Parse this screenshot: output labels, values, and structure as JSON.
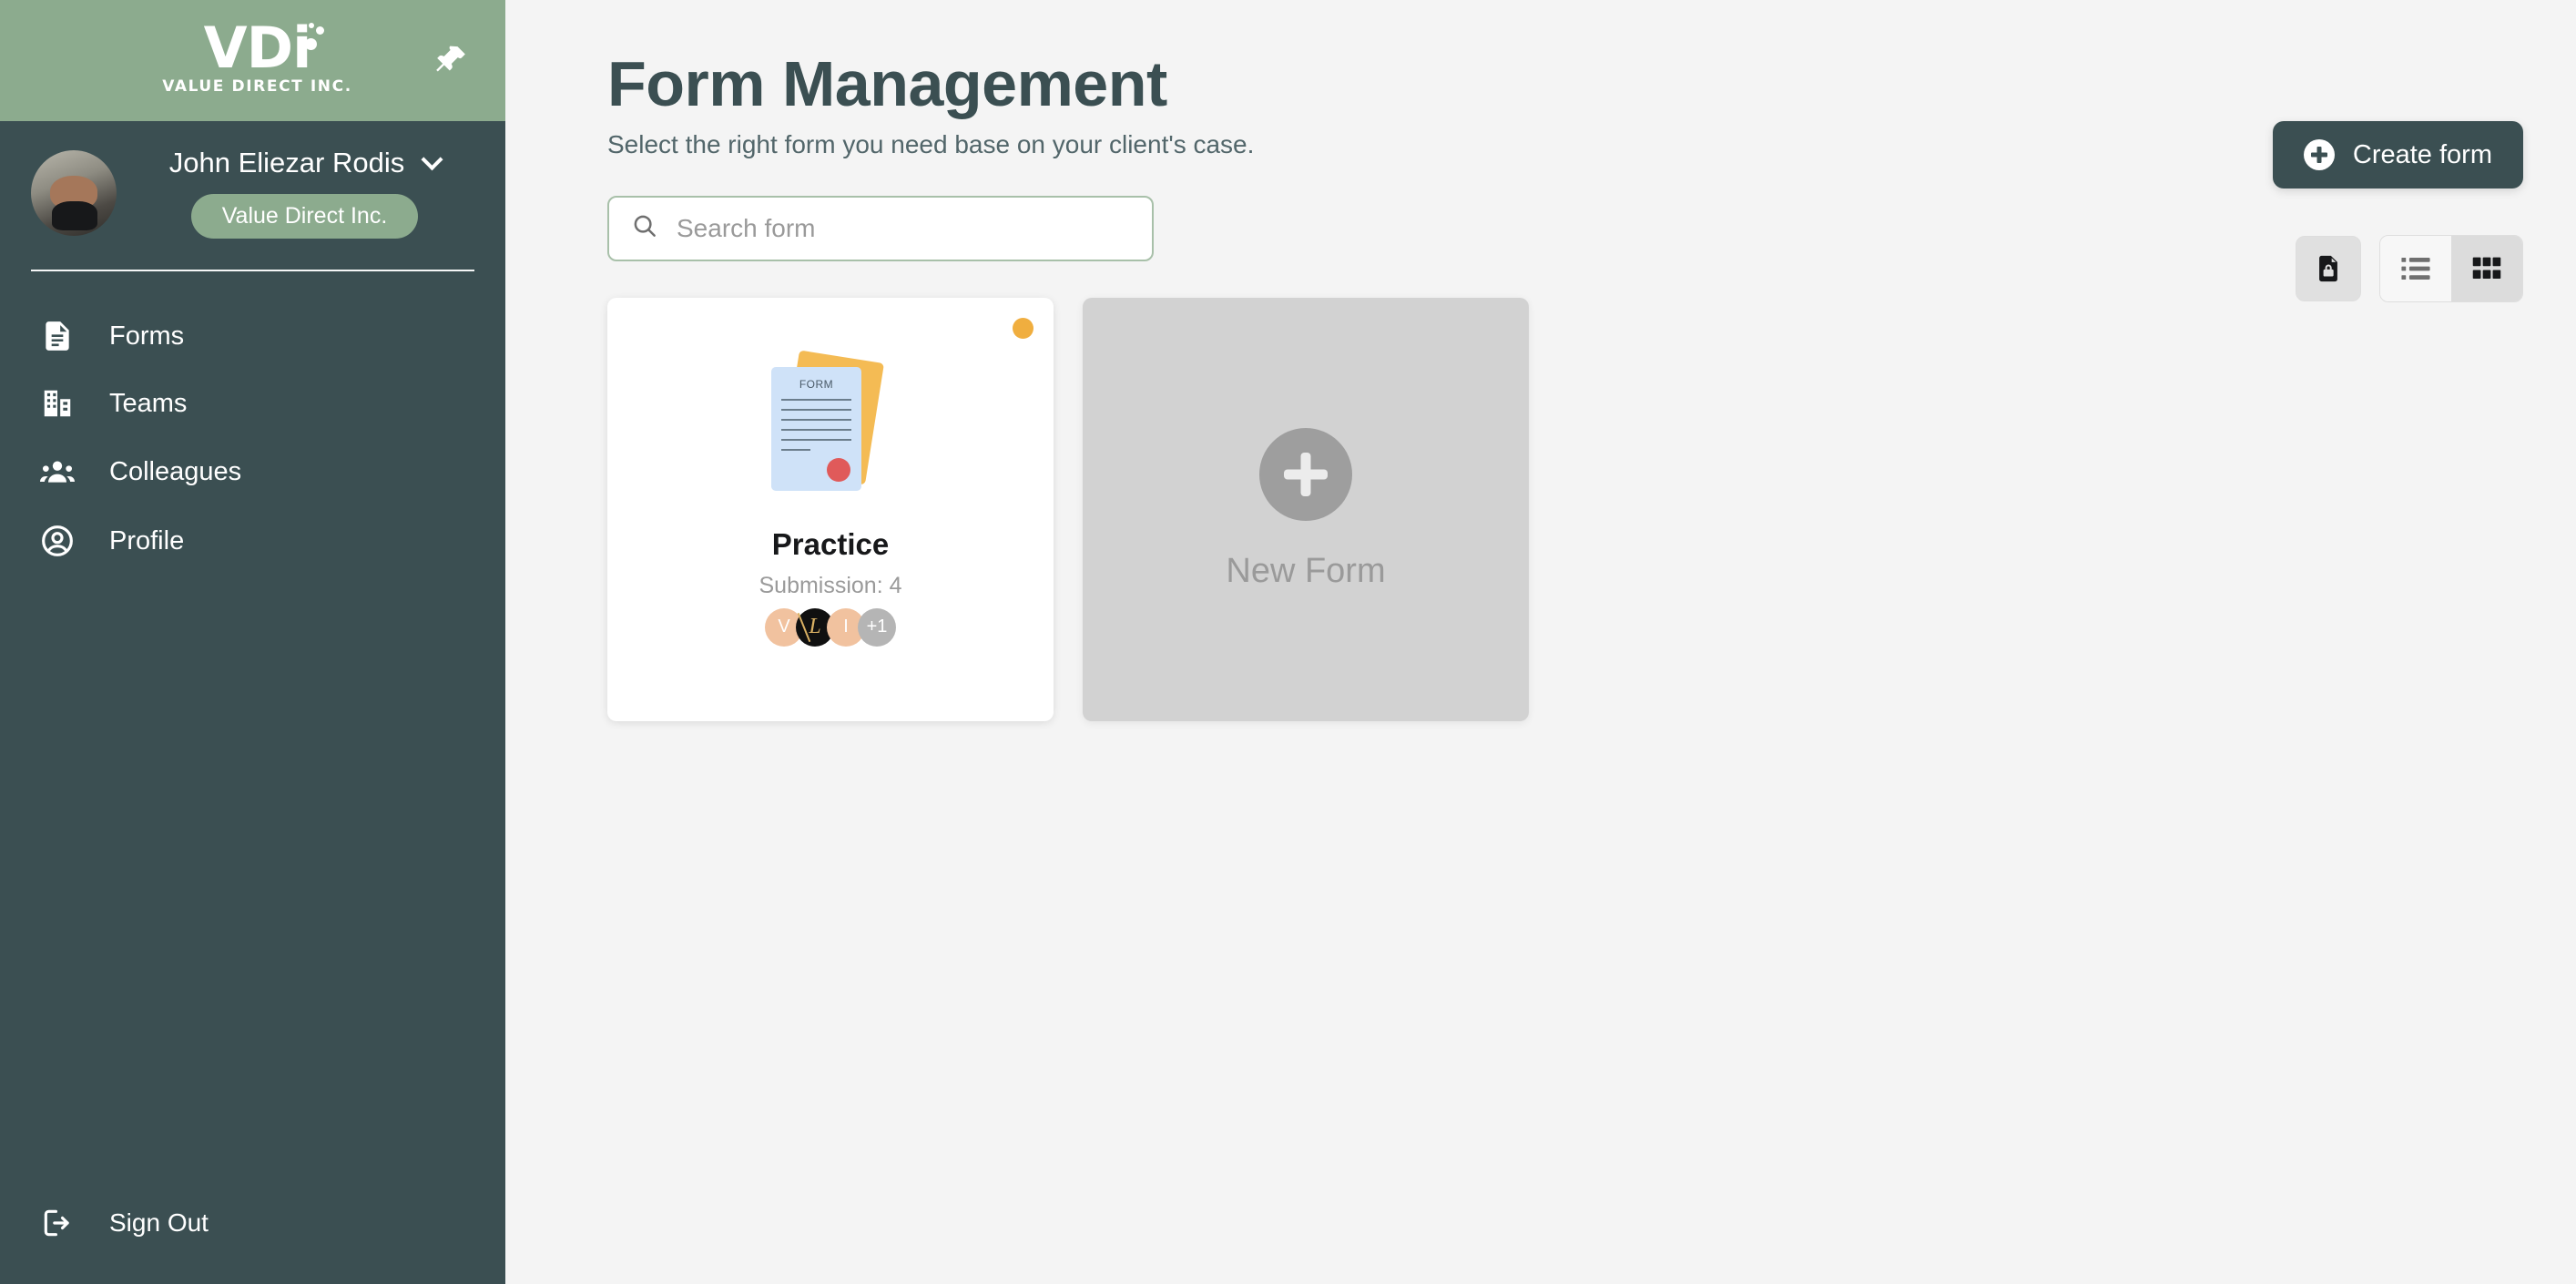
{
  "sidebar": {
    "logo": {
      "mark": "VDi",
      "subtitle": "VALUE DIRECT INC.",
      "pin_icon": "pushpin-icon"
    },
    "user": {
      "name": "John Eliezar Rodis",
      "organization": "Value Direct Inc.",
      "chevron_icon": "chevron-down-icon",
      "avatar_icon": "user-avatar-photo"
    },
    "items": [
      {
        "label": "Forms",
        "icon": "document-icon"
      },
      {
        "label": "Teams",
        "icon": "building-icon"
      },
      {
        "label": "Colleagues",
        "icon": "people-icon"
      },
      {
        "label": "Profile",
        "icon": "user-circle-icon"
      }
    ],
    "sign_out": {
      "label": "Sign Out",
      "icon": "logout-icon"
    }
  },
  "header": {
    "title": "Form Management",
    "subtitle": "Select the right form you need base on your client's case."
  },
  "toolbar": {
    "create_label": "Create form",
    "create_icon": "plus-circle-icon",
    "search_placeholder": "Search form",
    "search_value": "",
    "search_icon": "search-icon",
    "view_buttons": [
      {
        "icon": "locked-document-icon",
        "name": "locked-forms-button",
        "active": false
      },
      {
        "icon": "list-view-icon",
        "name": "list-view-button",
        "active": false
      },
      {
        "icon": "grid-view-icon",
        "name": "grid-view-button",
        "active": true
      }
    ]
  },
  "forms": {
    "cards": [
      {
        "title": "Practice",
        "submission_label": "Submission: 4",
        "status_color": "#f0ae3f",
        "illustration_label": "FORM",
        "members": [
          {
            "initial": "V",
            "style": "peach"
          },
          {
            "initial": "L",
            "style": "black"
          },
          {
            "initial": "I",
            "style": "peach"
          },
          {
            "initial": "+1",
            "style": "gray"
          }
        ]
      }
    ],
    "new_form": {
      "label": "New Form",
      "icon": "plus-icon"
    }
  },
  "colors": {
    "sidebar_header": "#8cab8e",
    "sidebar_body": "#3b4f52",
    "accent": "#8cab8e",
    "status_orange": "#f0ae3f",
    "page_bg": "#f4f4f4"
  }
}
